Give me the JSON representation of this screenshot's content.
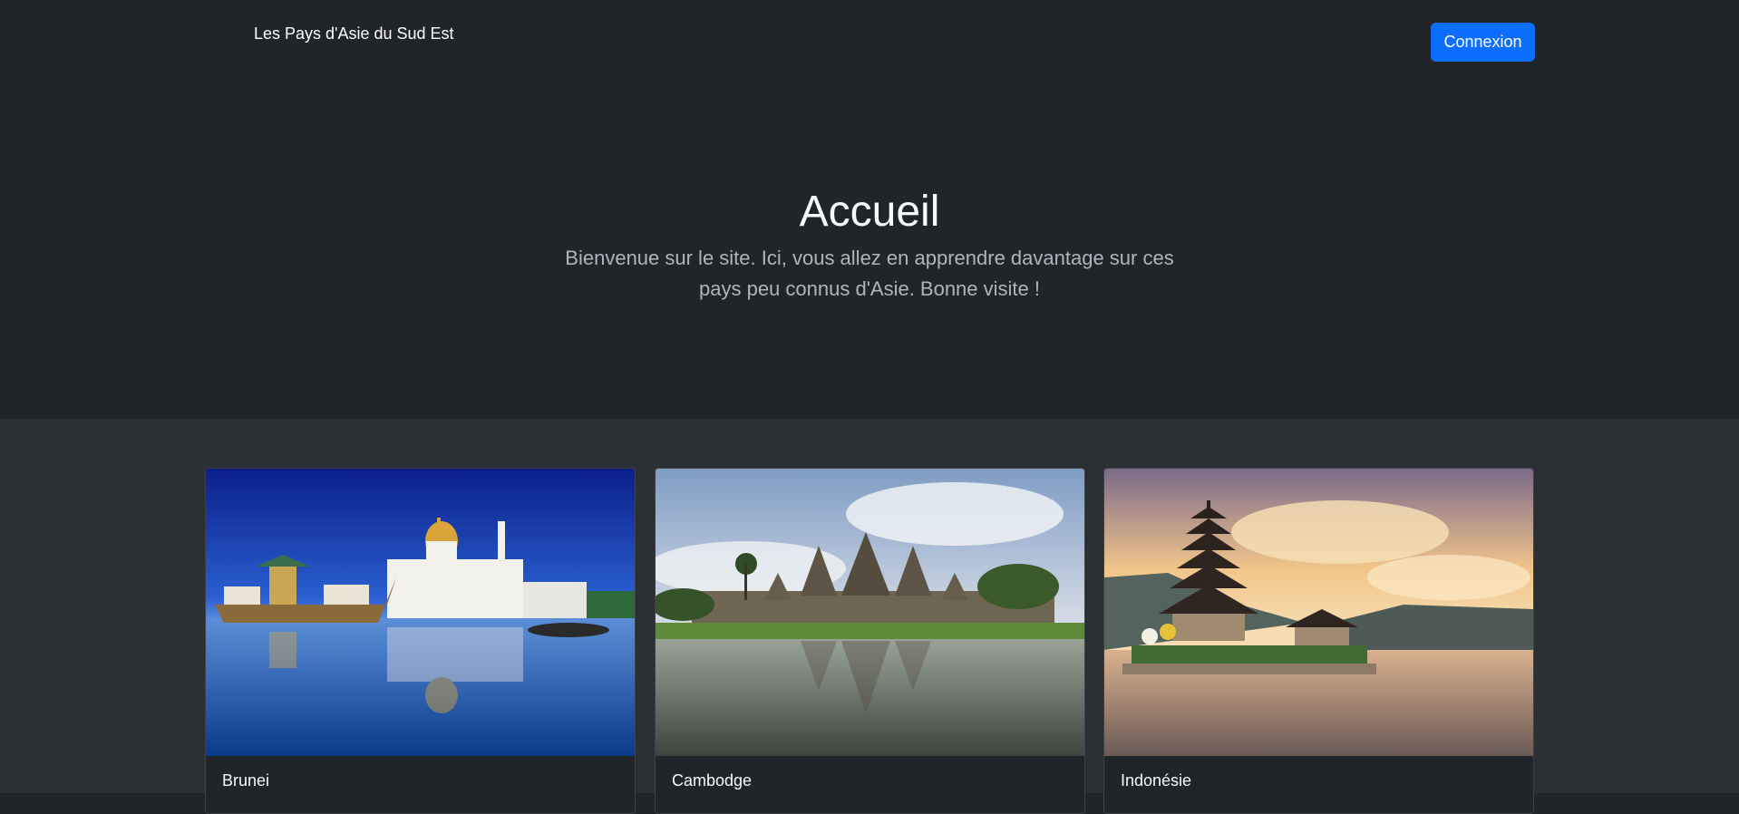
{
  "navbar": {
    "brand": "Les Pays d'Asie du Sud Est",
    "login_label": "Connexion"
  },
  "hero": {
    "title": "Accueil",
    "lead": "Bienvenue sur le site. Ici, vous allez en apprendre davantage sur ces pays peu connus d'Asie. Bonne visite !"
  },
  "cards": [
    {
      "title": "Brunei"
    },
    {
      "title": "Cambodge"
    },
    {
      "title": "Indonésie"
    }
  ],
  "colors": {
    "background": "#212529",
    "album_bg": "#2b3035",
    "primary": "#0d6efd"
  }
}
